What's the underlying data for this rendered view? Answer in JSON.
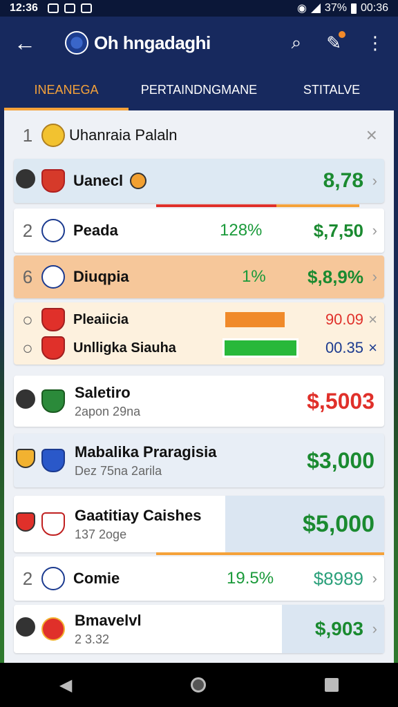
{
  "status": {
    "time": "12:36",
    "battery": "37%",
    "clock_right": "00:36"
  },
  "appbar": {
    "title": "Oh hngadaghi"
  },
  "tabs": [
    "INEANEGA",
    "PERTAINDNGMANE",
    "STITALVE"
  ],
  "colors": {
    "accent": "#f5a23a",
    "green": "#1a8a30",
    "red": "#e0302a",
    "blue": "#1b3a8f"
  },
  "header_row": {
    "rank": "1",
    "name": "Uhanraia Palaln"
  },
  "rows": [
    {
      "rank": "",
      "name": "Uanecl",
      "price": "8,78"
    },
    {
      "rank": "2",
      "name": "Peada",
      "pct": "128%",
      "price": "$,7,50"
    },
    {
      "rank": "6",
      "name": "Diuqpia",
      "pct": "1%",
      "price": "$,8,9%"
    },
    {
      "name": "Pleaiicia",
      "price": "90.09"
    },
    {
      "name": "Unlligka Siauha",
      "price": "00.35"
    },
    {
      "name": "Saletiro",
      "sub": "2apon 29na",
      "price": "$,5003"
    },
    {
      "name": "Mabalika Praragisia",
      "sub": "Dez 75na 2arila",
      "price": "$3,000"
    },
    {
      "name": "Gaatitiay Caishes",
      "sub": "137 2oge",
      "price": "$5,000"
    },
    {
      "rank": "2",
      "name": "Comie",
      "pct": "19.5%",
      "price": "$8989"
    },
    {
      "name": "Bmavelvl",
      "sub": "2 3.32",
      "price": "$,903"
    }
  ]
}
